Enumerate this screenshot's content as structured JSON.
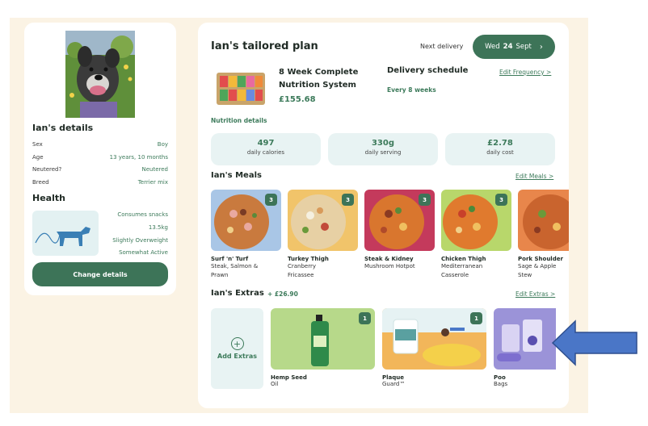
{
  "colors": {
    "brand_green": "#3d7458",
    "accent_green": "#3c7a5a",
    "card_tint": "#e8f3f3",
    "arrow_blue": "#4a76c7"
  },
  "dog": {
    "details_title": "Ian's details",
    "details": [
      {
        "label": "Sex",
        "value": "Boy"
      },
      {
        "label": "Age",
        "value": "13 years, 10 months"
      },
      {
        "label": "Neutered?",
        "value": "Neutered"
      },
      {
        "label": "Breed",
        "value": "Terrier mix"
      }
    ],
    "health_title": "Health",
    "health": [
      "Consumes snacks",
      "13.5kg",
      "Slightly Overweight",
      "Somewhat Active"
    ],
    "change_button": "Change details"
  },
  "plan": {
    "title": "Ian's tailored plan",
    "next_delivery_label": "Next delivery",
    "delivery_day": "Wed",
    "delivery_date": "24",
    "delivery_month": "Sept",
    "product_name": "8 Week Complete Nutrition System",
    "product_price": "£155.68",
    "schedule_title": "Delivery schedule",
    "schedule_value": "Every 8 weeks",
    "edit_frequency": "Edit Frequency >",
    "nutrition_title": "Nutrition details",
    "stats": [
      {
        "value": "497",
        "label": "daily calories"
      },
      {
        "value": "330g",
        "label": "daily serving"
      },
      {
        "value": "£2.78",
        "label": "daily cost"
      }
    ],
    "meals_title": "Ian's Meals",
    "edit_meals": "Edit Meals >",
    "meals": [
      {
        "name": "Surf 'n' Turf",
        "sub1": "Steak, Salmon &",
        "sub2": "Prawn",
        "qty": "3",
        "bg": "#a9c6e6"
      },
      {
        "name": "Turkey Thigh",
        "sub1": "Cranberry",
        "sub2": "Fricassee",
        "qty": "3",
        "bg": "#f1c46a"
      },
      {
        "name": "Steak & Kidney",
        "sub1": "Mushroom Hotpot",
        "sub2": "",
        "qty": "3",
        "bg": "#c43a5c"
      },
      {
        "name": "Chicken Thigh",
        "sub1": "Mediterranean",
        "sub2": "Casserole",
        "qty": "3",
        "bg": "#b8d76b"
      },
      {
        "name": "Pork Shoulder",
        "sub1": "Sage & Apple",
        "sub2": "Stew",
        "qty": "",
        "bg": "#e8864b"
      }
    ],
    "extras_title": "Ian's Extras",
    "extras_total": "+ £26.90",
    "edit_extras": "Edit Extras >",
    "add_extras": "Add Extras",
    "extras": [
      {
        "name": "Hemp Seed",
        "sub": "Oil",
        "qty": "1",
        "bg": "#b7d98a"
      },
      {
        "name": "Plaque",
        "sub": "Guard™",
        "qty": "1",
        "bg": "#f2b65a"
      },
      {
        "name": "Poo",
        "sub": "Bags",
        "qty": "",
        "bg": "#9b93d8"
      }
    ]
  }
}
